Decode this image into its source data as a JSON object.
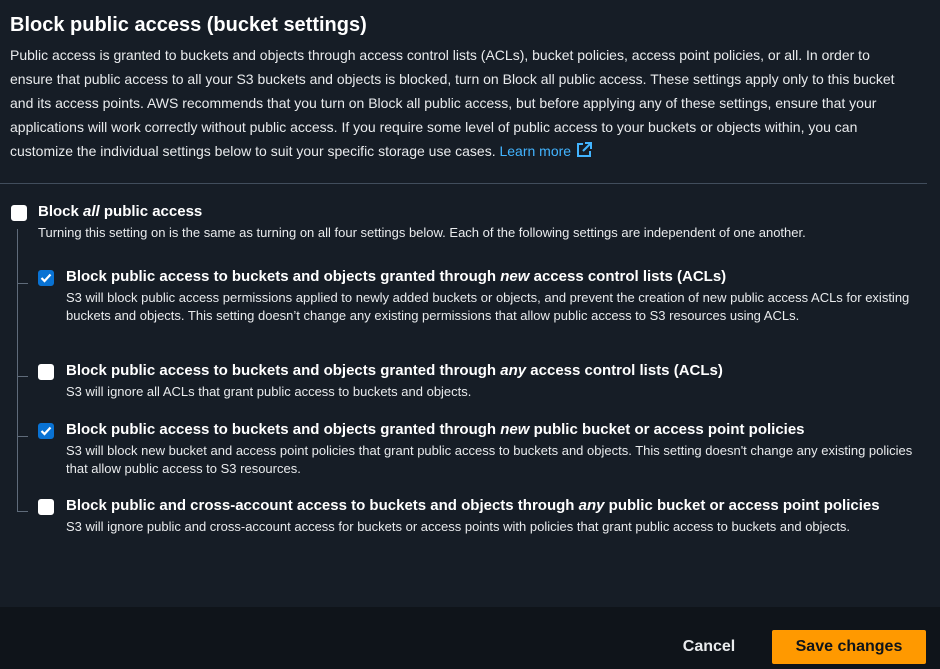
{
  "header": {
    "title": "Block public access (bucket settings)",
    "description": "Public access is granted to buckets and objects through access control lists (ACLs), bucket policies, access point policies, or all. In order to ensure that public access to all your S3 buckets and objects is blocked, turn on Block all public access. These settings apply only to this bucket and its access points. AWS recommends that you turn on Block all public access, but before applying any of these settings, ensure that your applications will work correctly without public access. If you require some level of public access to your buckets or objects within, you can customize the individual settings below to suit your specific storage use cases.",
    "learn_more": "Learn more",
    "learn_more_icon": "external-link-icon"
  },
  "block_all": {
    "label_pre": "Block ",
    "label_em": "all",
    "label_post": " public access",
    "description": "Turning this setting on is the same as turning on all four settings below. Each of the following settings are independent of one another.",
    "checked": false
  },
  "options": [
    {
      "label_pre": "Block public access to buckets and objects granted through ",
      "label_em": "new",
      "label_post": " access control lists (ACLs)",
      "description": "S3 will block public access permissions applied to newly added buckets or objects, and prevent the creation of new public access ACLs for existing buckets and objects. This setting doesn’t change any existing permissions that allow public access to S3 resources using ACLs.",
      "checked": true
    },
    {
      "label_pre": "Block public access to buckets and objects granted through ",
      "label_em": "any",
      "label_post": " access control lists (ACLs)",
      "description": "S3 will ignore all ACLs that grant public access to buckets and objects.",
      "checked": false
    },
    {
      "label_pre": "Block public access to buckets and objects granted through ",
      "label_em": "new",
      "label_post": " public bucket or access point policies",
      "description": "S3 will block new bucket and access point policies that grant public access to buckets and objects. This setting doesn't change any existing policies that allow public access to S3 resources.",
      "checked": true
    },
    {
      "label_pre": "Block public and cross-account access to buckets and objects through ",
      "label_em": "any",
      "label_post": " public bucket or access point policies",
      "description": "S3 will ignore public and cross-account access for buckets or access points with policies that grant public access to buckets and objects.",
      "checked": false
    }
  ],
  "footer": {
    "cancel_label": "Cancel",
    "save_label": "Save changes"
  },
  "colors": {
    "accent": "#ff9900",
    "link": "#42b4ff",
    "checkbox_checked": "#0972d3"
  }
}
